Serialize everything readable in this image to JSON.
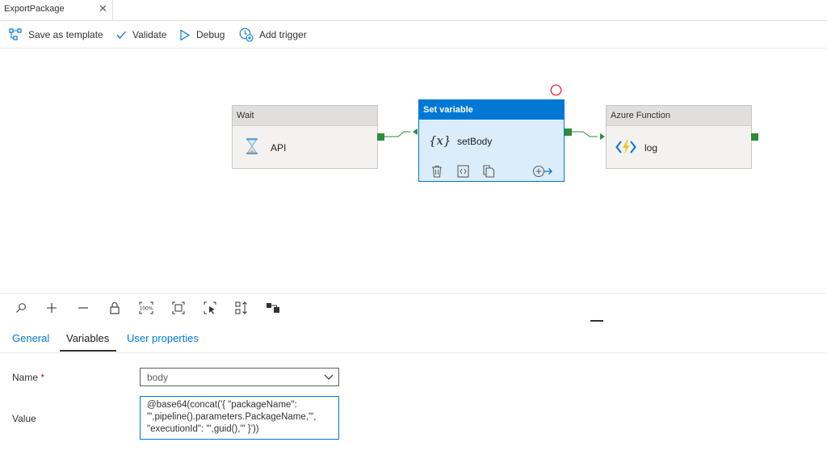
{
  "tab": {
    "title": "ExportPackage",
    "close_glyph": "✕"
  },
  "toolbar": {
    "save_template": "Save as template",
    "validate": "Validate",
    "debug": "Debug",
    "add_trigger": "Add trigger"
  },
  "pipeline": {
    "activities": [
      {
        "type": "Wait",
        "name": "API",
        "icon": "hourglass-icon"
      },
      {
        "type": "Set variable",
        "name": "setBody",
        "icon": "variable-icon",
        "selected": true,
        "glyph": "{x}"
      },
      {
        "type": "Azure Function",
        "name": "log",
        "icon": "azure-function-icon"
      }
    ]
  },
  "canvas_tools": [
    "search-icon",
    "zoom-in-icon",
    "zoom-out-icon",
    "lock-icon",
    "zoom-100-icon",
    "fit-to-window-icon",
    "select-icon",
    "auto-align-icon",
    "layout-icon"
  ],
  "zoom_label": "100%",
  "properties": {
    "tabs": [
      "General",
      "Variables",
      "User properties"
    ],
    "active_tab": "Variables",
    "name_label": "Name",
    "required_mark": "*",
    "name_value": "body",
    "value_label": "Value",
    "value_lines": [
      "@base64(concat('{ \"packageName\":",
      "\"',pipeline().parameters.PackageName,'\",",
      "\"executionId\": \"',guid(),'\" }'))"
    ]
  },
  "colors": {
    "accent": "#0078d4",
    "port": "#2e8b3a",
    "error": "#e81123"
  }
}
